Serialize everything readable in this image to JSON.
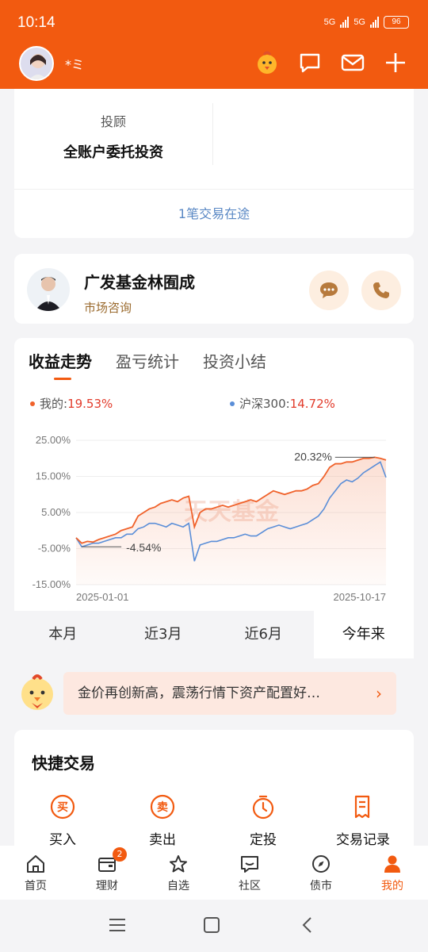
{
  "status": {
    "time": "10:14",
    "net1": "5G",
    "net2": "5G",
    "battery": "96"
  },
  "header": {
    "nickname": "*ミ"
  },
  "advisor": {
    "label": "投顾",
    "value": "全账户委托投资",
    "pending": "1笔交易在途"
  },
  "consultant": {
    "name": "广发基金林囿成",
    "subtitle": "市场咨询"
  },
  "chart_tabs": [
    "收益走势",
    "盈亏统计",
    "投资小结"
  ],
  "legend": {
    "mine_label": "我的:",
    "mine_value": "19.53%",
    "index_label": "沪深300:",
    "index_value": "14.72%"
  },
  "ranges": [
    "本月",
    "近3月",
    "近6月",
    "今年来"
  ],
  "chart_data": {
    "type": "line",
    "ylim": [
      -15,
      25
    ],
    "y_ticks": [
      "25.00%",
      "15.00%",
      "5.00%",
      "-5.00%",
      "-15.00%"
    ],
    "x_start": "2025-01-01",
    "x_end": "2025-10-17",
    "watermark": "天天基金",
    "annotations": {
      "max": "20.32%",
      "min": "-4.54%"
    },
    "series": [
      {
        "name": "我的",
        "color": "#f0622b",
        "values": [
          -2.0,
          -3.5,
          -3.0,
          -3.2,
          -2.5,
          -2.0,
          -1.5,
          -1.0,
          0.0,
          0.5,
          1.0,
          4.0,
          5.0,
          6.0,
          6.5,
          7.5,
          8.0,
          8.5,
          8.0,
          9.0,
          9.5,
          1.0,
          5.0,
          6.0,
          6.0,
          6.5,
          7.0,
          6.5,
          7.0,
          7.5,
          8.0,
          8.5,
          8.0,
          9.0,
          10.0,
          11.0,
          10.5,
          10.0,
          10.5,
          11.0,
          11.0,
          11.5,
          12.5,
          13.0,
          15.0,
          17.5,
          18.5,
          18.5,
          19.0,
          19.0,
          19.5,
          20.0,
          20.0,
          20.3,
          20.0,
          19.53
        ]
      },
      {
        "name": "沪深300",
        "color": "#5a8ed8",
        "values": [
          -2.0,
          -4.5,
          -4.0,
          -3.5,
          -3.5,
          -3.0,
          -2.5,
          -2.0,
          -2.0,
          -1.0,
          -1.0,
          0.5,
          1.0,
          2.0,
          2.0,
          1.5,
          1.0,
          2.0,
          1.5,
          1.0,
          2.0,
          -8.5,
          -4.0,
          -3.5,
          -3.0,
          -3.0,
          -2.5,
          -2.0,
          -2.0,
          -1.5,
          -1.0,
          -1.5,
          -1.5,
          -0.5,
          0.5,
          1.0,
          1.5,
          1.0,
          0.5,
          1.0,
          1.5,
          2.0,
          3.0,
          4.0,
          6.0,
          9.0,
          11.0,
          13.0,
          14.0,
          13.5,
          14.5,
          16.0,
          17.0,
          18.0,
          19.0,
          14.72
        ]
      }
    ]
  },
  "banner": {
    "text": "金价再创新高，震荡行情下资产配置好…"
  },
  "quick_trade": {
    "title": "快捷交易",
    "items": [
      {
        "label": "买入",
        "glyph": "买"
      },
      {
        "label": "卖出",
        "glyph": "卖"
      },
      {
        "label": "定投"
      },
      {
        "label": "交易记录"
      }
    ]
  },
  "tabbar": {
    "items": [
      {
        "label": "首页"
      },
      {
        "label": "理财",
        "badge": "2"
      },
      {
        "label": "自选"
      },
      {
        "label": "社区"
      },
      {
        "label": "债市"
      },
      {
        "label": "我的"
      }
    ]
  },
  "colors": {
    "brand": "#f25a10",
    "up": "#e23b2b",
    "link": "#5a88c4"
  }
}
